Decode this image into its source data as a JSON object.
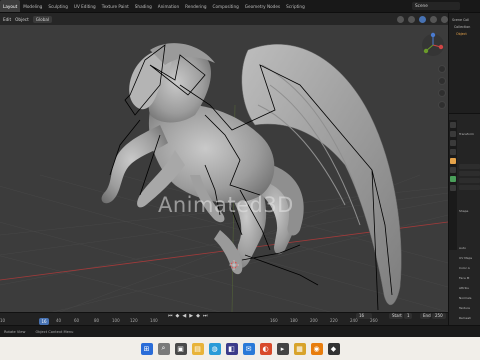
{
  "topbar": {
    "tabs": [
      "Layout",
      "Modeling",
      "Sculpting",
      "UV Editing",
      "Texture Paint",
      "Shading",
      "Animation",
      "Rendering",
      "Compositing",
      "Geometry Nodes",
      "Scripting"
    ],
    "active_tab": "Layout",
    "scene": "Scene"
  },
  "header": {
    "mode": "Edit",
    "object_menu": "Object",
    "orientation": "Global"
  },
  "viewport": {
    "watermark": "Animated3D",
    "options_label": "Options"
  },
  "properties": {
    "labels": [
      "Scene Coll",
      "Collection",
      "Object",
      "Transform",
      "Shape",
      "Auto",
      "UV Maps",
      "Color A",
      "Face M",
      "Attribu",
      "Normals",
      "Texture",
      "Remesh",
      "Geome",
      "Custom"
    ]
  },
  "timeline": {
    "current_frame": "16",
    "start_label": "Start",
    "start_value": "1",
    "end_label": "End",
    "end_value": "250",
    "playback_value": "16",
    "ticks": [
      "10",
      "40",
      "60",
      "80",
      "100",
      "120",
      "140",
      "160",
      "180",
      "200",
      "220",
      "240",
      "260"
    ]
  },
  "status": {
    "left": "Rotate View",
    "right": "Object Context Menu"
  },
  "colors": {
    "viewport_bg": "#3c3c3c",
    "accent": "#4772b3",
    "axis_red": "#b23434",
    "axis_green": "#6a9a2a"
  }
}
